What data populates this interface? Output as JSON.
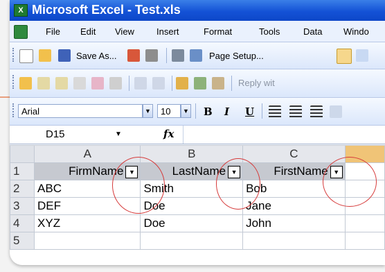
{
  "window": {
    "title": "Microsoft Excel - Test.xls",
    "app_icon": "excel-icon"
  },
  "menu": [
    "File",
    "Edit",
    "View",
    "Insert",
    "Format",
    "Tools",
    "Data",
    "Windo"
  ],
  "toolbar1": {
    "save_as": "Save As...",
    "page_setup": "Page Setup..."
  },
  "toolbar2": {
    "reply": "Reply wit"
  },
  "formatting": {
    "font": "Arial",
    "size": "10",
    "bold": "B",
    "italic": "I",
    "underline": "U"
  },
  "formula_bar": {
    "cell_ref": "D15",
    "fx": "fx",
    "content": ""
  },
  "grid": {
    "columns": [
      "A",
      "B",
      "C"
    ],
    "rows": [
      {
        "num": "1",
        "cells": [
          "FirmName",
          "LastName",
          "FirstName"
        ]
      },
      {
        "num": "2",
        "cells": [
          "ABC",
          "Smith",
          "Bob"
        ]
      },
      {
        "num": "3",
        "cells": [
          "DEF",
          "Doe",
          "Jane"
        ]
      },
      {
        "num": "4",
        "cells": [
          "XYZ",
          "Doe",
          "John"
        ]
      },
      {
        "num": "5",
        "cells": [
          "",
          "",
          ""
        ]
      }
    ]
  },
  "colors": {
    "title_bar": "#1452d6",
    "highlight_col": "#f0c477",
    "annotation": "#d63a3a"
  }
}
